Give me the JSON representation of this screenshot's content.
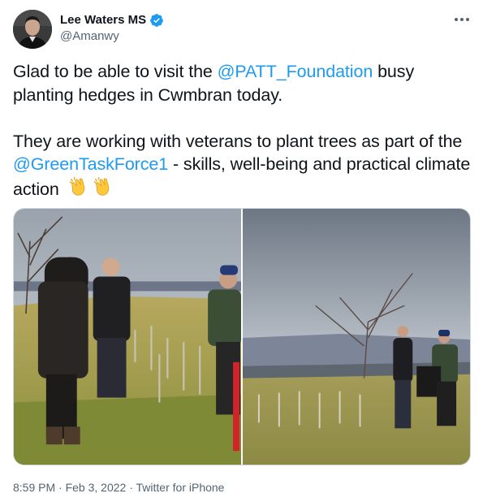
{
  "author": {
    "display_name": "Lee Waters MS",
    "handle": "@Amanwy",
    "verified": true,
    "verified_icon": "verified-badge-icon",
    "avatar_icon": "profile-avatar"
  },
  "tweet": {
    "para1_before": "Glad to be able to visit the ",
    "para1_mention": "@PATT_Foundation",
    "para1_after": " busy planting hedges in Cwmbran today.",
    "para2_before": "They are working with veterans to plant trees as part of the ",
    "para2_mention": "@GreenTaskForce1",
    "para2_after": " - skills, well-being and practical climate action ",
    "emoji": [
      "clapping-hands-icon",
      "clapping-hands-icon"
    ]
  },
  "media": {
    "photos": [
      "tree-planting-photo-1",
      "tree-planting-photo-2"
    ]
  },
  "meta": {
    "time": "8:59 PM",
    "sep1": " · ",
    "date": "Feb 3, 2022",
    "sep2": " · ",
    "source": "Twitter for iPhone"
  },
  "colors": {
    "link": "#1d9bf0",
    "text": "#0f1419",
    "secondary": "#536471"
  }
}
